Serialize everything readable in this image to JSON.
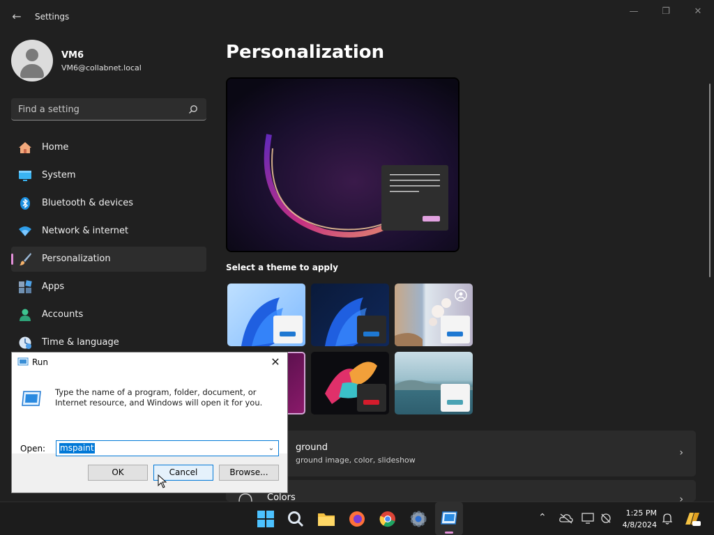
{
  "window": {
    "title": "Settings",
    "back_symbol": "←",
    "minimize_symbol": "—",
    "restore_symbol": "❐",
    "close_symbol": "✕"
  },
  "profile": {
    "name": "VM6",
    "email": "VM6@collabnet.local"
  },
  "search": {
    "placeholder": "Find a setting",
    "icon": "search-icon"
  },
  "nav": {
    "items": [
      {
        "label": "Home",
        "icon": "home-icon"
      },
      {
        "label": "System",
        "icon": "system-icon"
      },
      {
        "label": "Bluetooth & devices",
        "icon": "bluetooth-icon"
      },
      {
        "label": "Network & internet",
        "icon": "wifi-icon"
      },
      {
        "label": "Personalization",
        "icon": "brush-icon",
        "active": true
      },
      {
        "label": "Apps",
        "icon": "apps-icon"
      },
      {
        "label": "Accounts",
        "icon": "accounts-icon"
      },
      {
        "label": "Time & language",
        "icon": "clock-icon"
      }
    ]
  },
  "main": {
    "title": "Personalization",
    "theme_heading": "Select a theme to apply",
    "cards": [
      {
        "title": "ground",
        "subtitle": "ground image, color, slideshow"
      },
      {
        "title": "Colors"
      }
    ],
    "chevron": "›"
  },
  "run_dialog": {
    "title": "Run",
    "close_symbol": "✕",
    "description": "Type the name of a program, folder, document, or Internet resource, and Windows will open it for you.",
    "open_label": "Open:",
    "open_value": "mspaint",
    "dropdown_symbol": "⌄",
    "buttons": {
      "ok": "OK",
      "cancel": "Cancel",
      "browse": "Browse..."
    }
  },
  "taskbar": {
    "apps": [
      "start-icon",
      "search-icon",
      "file-explorer-icon",
      "firefox-icon",
      "chrome-icon",
      "settings-icon",
      "run-icon"
    ],
    "tray": [
      "chevron-up-icon",
      "onedrive-icon",
      "display-icon",
      "network-icon",
      "notification-bell-icon",
      "copilot-icon"
    ],
    "chevron_symbol": "⌃",
    "time": "1:25 PM",
    "date": "4/8/2024"
  },
  "colors": {
    "accent": "#0078d7",
    "nav_active_indicator": "#e28fd8",
    "background": "#202020"
  }
}
